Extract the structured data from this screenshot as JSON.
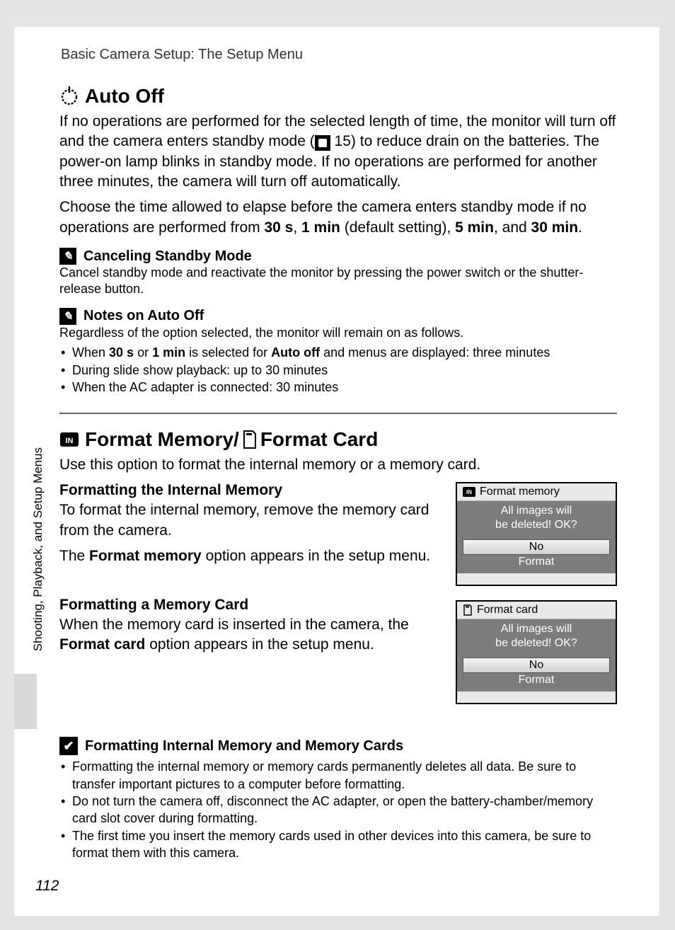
{
  "running_head": "Basic Camera Setup: The Setup Menu",
  "side_label": "Shooting, Playback, and Setup Menus",
  "page_number": "112",
  "auto_off": {
    "title": "Auto Off",
    "p1_a": "If no operations are performed for the selected length of time, the monitor will turn off and the camera enters standby mode (",
    "p1_ref": "15",
    "p1_b": ") to reduce drain on the batteries. The power-on lamp blinks in standby mode. If no operations are performed for another three minutes, the camera will turn off automatically.",
    "p2_a": "Choose the time allowed to elapse before the camera enters standby mode if no operations are performed from ",
    "opt1": "30 s",
    "opt2": "1 min",
    "opt_default": " (default setting), ",
    "opt3": "5 min",
    "and": ", and ",
    "opt4": "30 min",
    "period": ".",
    "cancel_title": "Canceling Standby Mode",
    "cancel_body": "Cancel standby mode and reactivate the monitor by pressing the power switch or the shutter-release button.",
    "notes_title": "Notes on Auto Off",
    "notes_intro": "Regardless of the option selected, the monitor will remain on as follows.",
    "notes": {
      "n1_a": "When ",
      "n1_b30": "30 s",
      "n1_or": " or ",
      "n1_b1m": "1 min",
      "n1_mid": " is selected for ",
      "n1_ao": "Auto off",
      "n1_rest": " and menus are displayed: three minutes",
      "n2": "During slide show playback: up to 30 minutes",
      "n3": "When the AC adapter is connected: 30 minutes"
    }
  },
  "format": {
    "title_a": "Format Memory/",
    "title_b": "Format Card",
    "intro": "Use this option to format the internal memory or a memory card.",
    "mem_h": "Formatting the Internal Memory",
    "mem_p1": "To format the internal memory, remove the memory card from the camera.",
    "mem_p2_a": "The ",
    "mem_p2_b": "Format memory",
    "mem_p2_c": " option appears in the setup menu.",
    "card_h": "Formatting a Memory Card",
    "card_p_a": "When the memory card is inserted in the camera, the ",
    "card_p_b": "Format card",
    "card_p_c": " option appears in the setup menu.",
    "lcd_mem": {
      "title": "Format memory",
      "l1": "All images will",
      "l2": "be deleted! OK?",
      "no": "No",
      "fmt": "Format"
    },
    "lcd_card": {
      "title": "Format card",
      "l1": "All images will",
      "l2": "be deleted! OK?",
      "no": "No",
      "fmt": "Format"
    },
    "warn_title": "Formatting Internal Memory and Memory Cards",
    "warn": {
      "w1": "Formatting the internal memory or memory cards permanently deletes all data. Be sure to transfer important pictures to a computer before formatting.",
      "w2": "Do not turn the camera off, disconnect the AC adapter, or open the battery-chamber/memory card slot cover during formatting.",
      "w3": "The first time you insert the memory cards used in other devices into this camera, be sure to format them with this camera."
    }
  }
}
